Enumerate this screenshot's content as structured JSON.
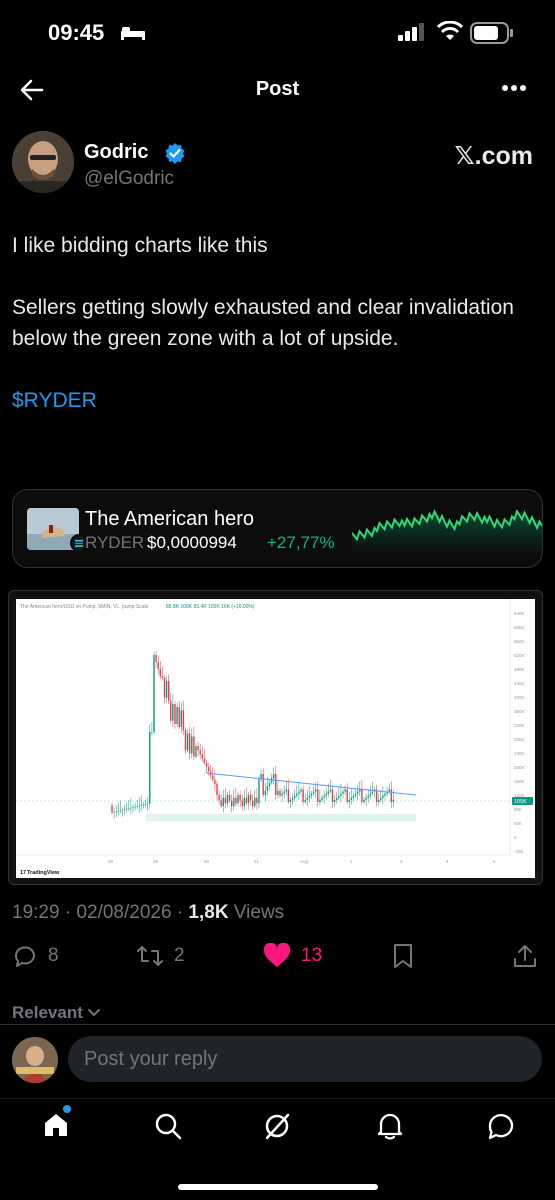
{
  "status": {
    "time": "09:45"
  },
  "nav": {
    "title": "Post"
  },
  "author": {
    "display_name": "Godric",
    "handle": "@elGodric",
    "watermark": "𝕏.com"
  },
  "post": {
    "paragraphs": [
      "I like bidding charts like this",
      "Sellers getting slowly exhausted and clear invalidation below the green zone with a lot of upside."
    ],
    "cashtag": "$RYDER"
  },
  "token_card": {
    "name": "The American hero",
    "ticker": "RYDER",
    "price": "$0,0000994",
    "change": "+27,77%",
    "change_color": "#00ba7c"
  },
  "chart_data": {
    "type": "candlestick",
    "header": "The American hero/USD on Pump, 5MIN, VL, pump Scale",
    "header_values": "88.8K  109K  83.4K  105K  16K (+16.00%)",
    "y_ticks": [
      "640K",
      "600K",
      "560K",
      "520K",
      "480K",
      "440K",
      "400K",
      "360K",
      "320K",
      "280K",
      "240K",
      "200K",
      "160K",
      "120K",
      "80K",
      "40K",
      "0",
      "-40K"
    ],
    "x_ticks": [
      "28",
      "29",
      "30",
      "31",
      "Aug",
      "2",
      "3",
      "4",
      "5"
    ],
    "last_price_label": "105K",
    "footer": "TradingView",
    "ylim": [
      -40000,
      660000
    ]
  },
  "meta": {
    "time": "19:29",
    "date": "02/08/2026",
    "views_count": "1,8K",
    "views_label": "Views"
  },
  "actions": {
    "replies": "8",
    "reposts": "2",
    "likes": "13",
    "like_color": "#f91880"
  },
  "relevant_label": "Relevant",
  "reply": {
    "placeholder": "Post your reply"
  },
  "colors": {
    "accent": "#1d9bf0",
    "background": "#000000",
    "muted": "#71767b"
  }
}
